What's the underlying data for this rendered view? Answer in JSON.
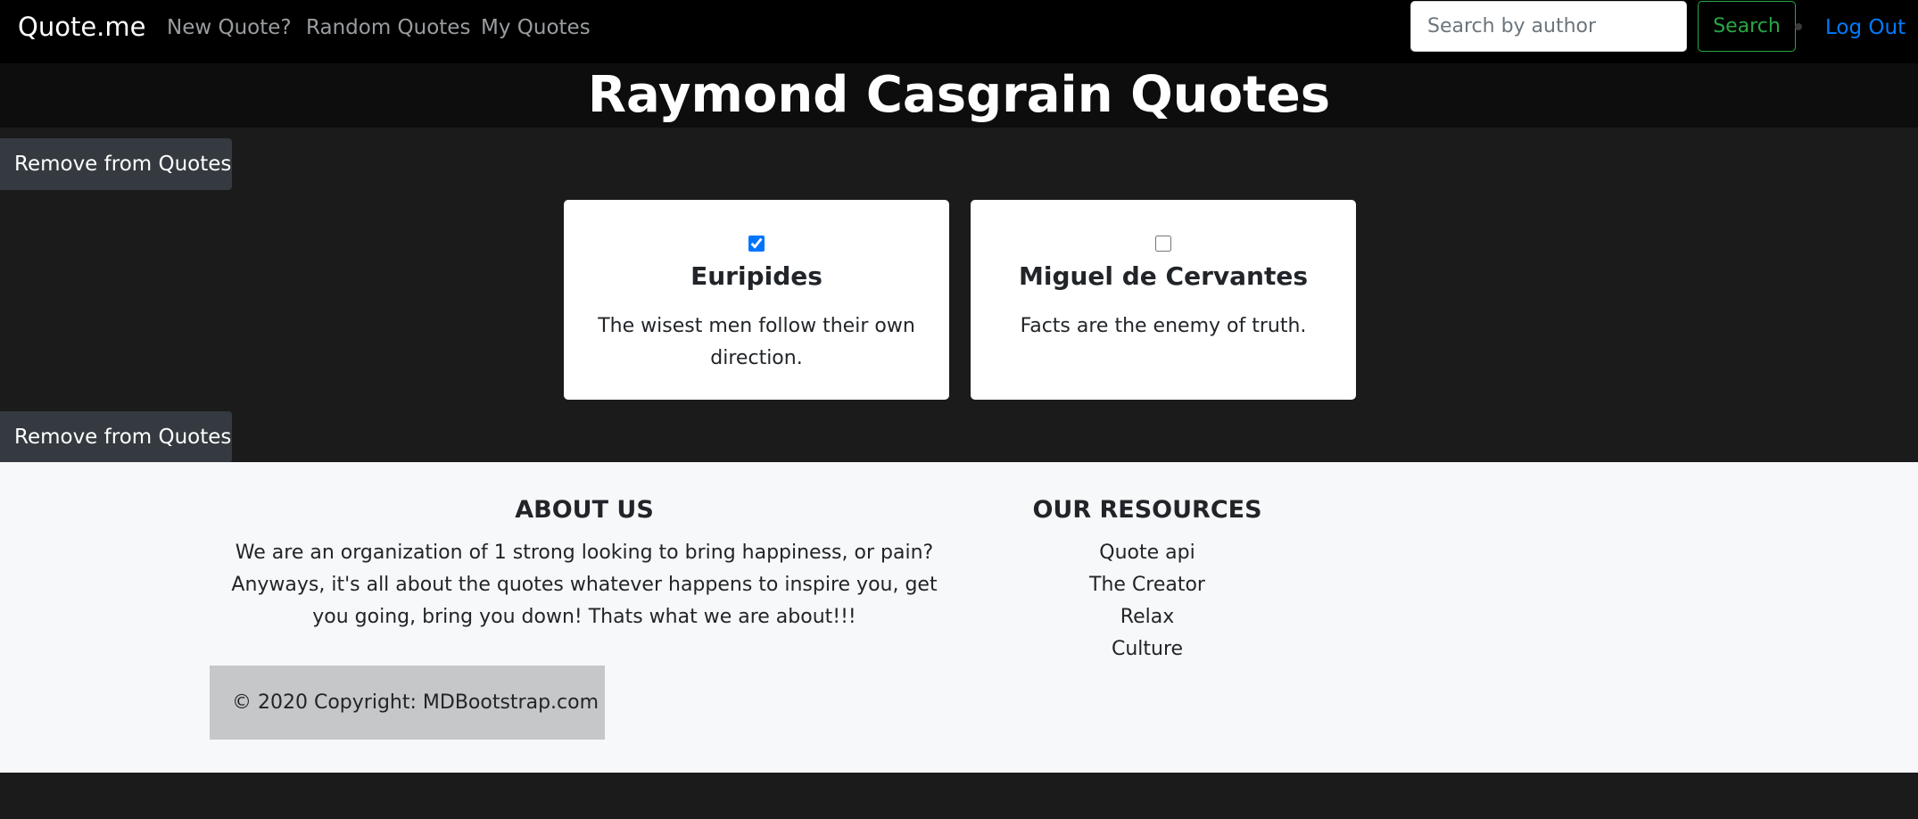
{
  "navbar": {
    "brand": "Quote.me",
    "links": [
      "New Quote?",
      "Random Quotes",
      "My Quotes"
    ],
    "search_placeholder": "Search by author",
    "search_button": "Search",
    "logout": "Log Out",
    "colors": {
      "background": "#000000",
      "search_accent": "#28a745",
      "logout": "#007bff"
    }
  },
  "page": {
    "title": "Raymond Casgrain Quotes",
    "remove_button": "Remove from Quotes"
  },
  "cards": [
    {
      "author": "Euripides",
      "quote": "The wisest men follow their own direction.",
      "checked": true
    },
    {
      "author": "Miguel de Cervantes",
      "quote": "Facts are the enemy of truth.",
      "checked": false
    }
  ],
  "footer": {
    "about_heading": "ABOUT US",
    "about_text": "We are an organization of 1 strong looking to bring happiness, or pain? Anyways, it's all about the quotes whatever happens to inspire you, get you going, bring you down! Thats what we are about!!!",
    "resources_heading": "OUR RESOURCES",
    "resources": [
      "Quote api",
      "The Creator",
      "Relax",
      "Culture"
    ],
    "copyright_prefix": "© 2020 Copyright: ",
    "copyright_link": "MDBootstrap.com"
  }
}
